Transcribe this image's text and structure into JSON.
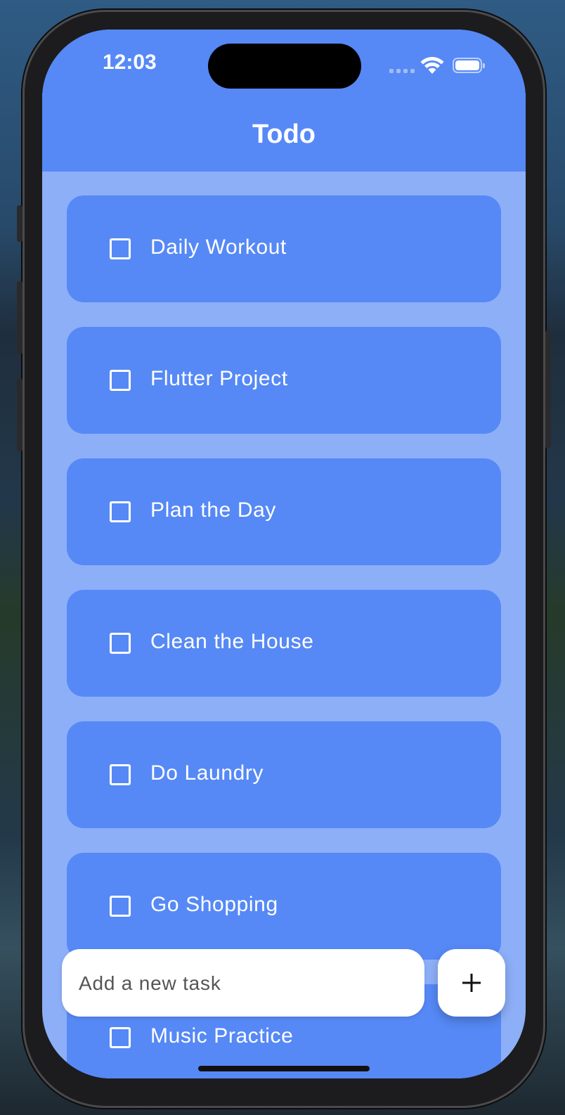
{
  "status_bar": {
    "time": "12:03"
  },
  "app": {
    "title": "Todo"
  },
  "todos": [
    {
      "label": "Daily Workout",
      "checked": false
    },
    {
      "label": "Flutter Project",
      "checked": false
    },
    {
      "label": "Plan the Day",
      "checked": false
    },
    {
      "label": "Clean the House",
      "checked": false
    },
    {
      "label": "Do Laundry",
      "checked": false
    },
    {
      "label": "Go Shopping",
      "checked": false
    },
    {
      "label": "Music Practice",
      "checked": false
    }
  ],
  "new_task": {
    "placeholder": "Add a new task",
    "value": ""
  },
  "add_button": {
    "icon": "plus-icon"
  },
  "colors": {
    "header": "#5689f6",
    "background": "#8daff8",
    "card": "#5689f6",
    "text": "#ffffff"
  }
}
